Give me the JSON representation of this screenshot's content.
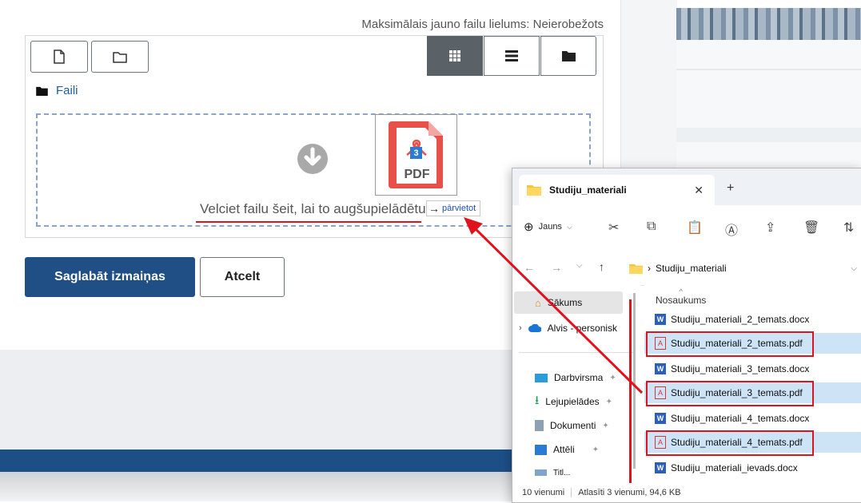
{
  "moodle": {
    "max_size_label": "Maksimālais jauno failu lielums: Neierobežots",
    "breadcrumb_folder": "Faili",
    "drop_text": "Velciet failu šeit, lai to augšupielādētu",
    "move_tooltip": "pārvietot",
    "save_button": "Saglabāt izmaiņas",
    "cancel_button": "Atcelt",
    "dragged_file_badge": "3",
    "dragged_file_type": "PDF",
    "colors": {
      "primary": "#1f4f85",
      "annotation_red": "#e0121b"
    }
  },
  "explorer": {
    "tab_title": "Studiju_materiali",
    "new_button": "Jauns",
    "address_path": "Studiju_materiali",
    "column_header": "Nosaukums",
    "nav": [
      {
        "label": "Sākums",
        "icon": "home-icon"
      },
      {
        "label": "Alvis - personisk",
        "icon": "onedrive-cloud-icon"
      },
      {
        "label": "Darbvirsma",
        "icon": "desktop-icon"
      },
      {
        "label": "Lejupielādes",
        "icon": "download-icon"
      },
      {
        "label": "Dokumenti",
        "icon": "documents-icon"
      },
      {
        "label": "Attēli",
        "icon": "pictures-icon"
      },
      {
        "label": "Titl...",
        "icon": "folder-icon"
      }
    ],
    "files": [
      {
        "name": "Studiju_materiali_2_temats.docx",
        "type": "docx",
        "selected": false
      },
      {
        "name": "Studiju_materiali_2_temats.pdf",
        "type": "pdf",
        "selected": true
      },
      {
        "name": "Studiju_materiali_3_temats.docx",
        "type": "docx",
        "selected": false
      },
      {
        "name": "Studiju_materiali_3_temats.pdf",
        "type": "pdf",
        "selected": true
      },
      {
        "name": "Studiju_materiali_4_temats.docx",
        "type": "docx",
        "selected": false
      },
      {
        "name": "Studiju_materiali_4_temats.pdf",
        "type": "pdf",
        "selected": true
      },
      {
        "name": "Studiju_materiali_ievads.docx",
        "type": "docx",
        "selected": false
      }
    ],
    "status_count": "10 vienumi",
    "status_selected": "Atlasīti 3 vienumi, 94,6 KB"
  }
}
